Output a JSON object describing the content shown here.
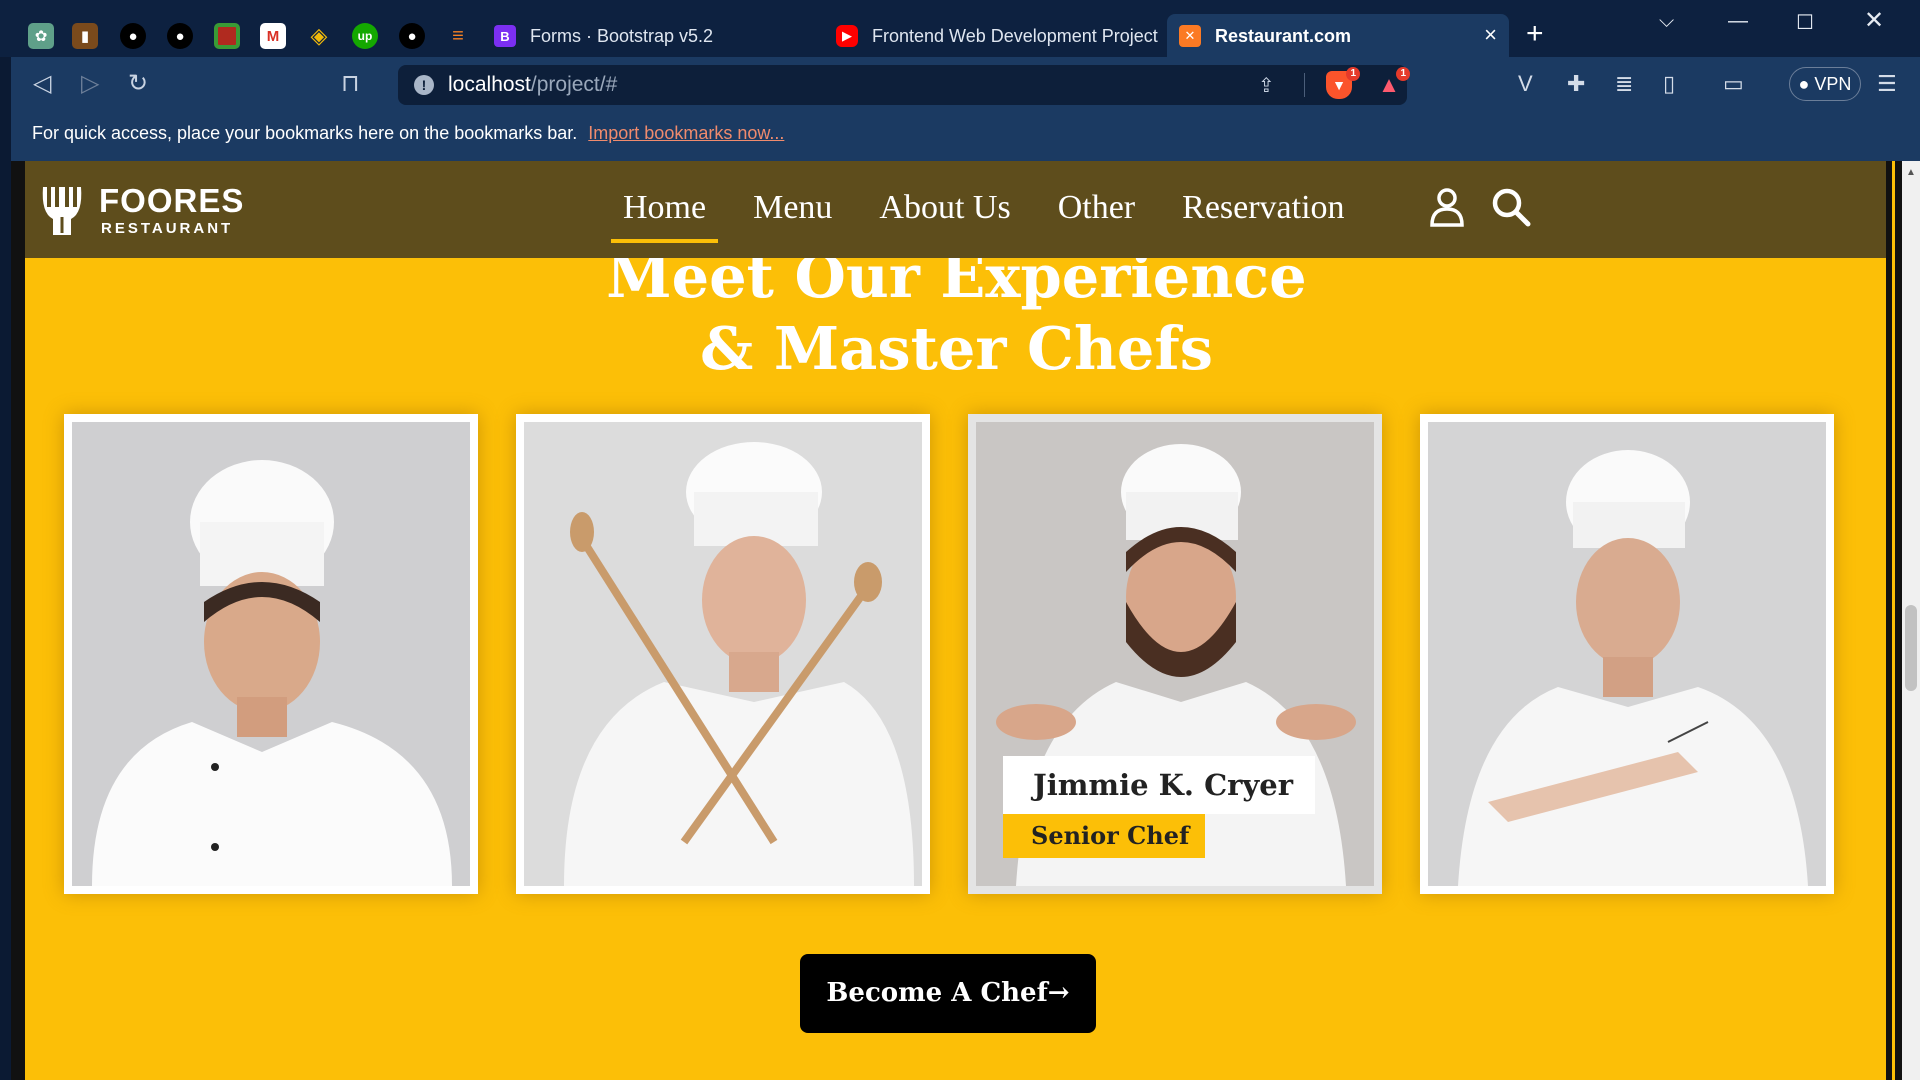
{
  "browser": {
    "tabs": [
      {
        "title": "Forms · Bootstrap v5.2",
        "favicon": "B"
      },
      {
        "title": "Frontend Web Development Project",
        "favicon": "yt"
      },
      {
        "title": "Restaurant.com",
        "favicon": "xampp"
      }
    ],
    "pinned_icons": [
      "openai-icon",
      "book-icon",
      "github-icon",
      "github-icon",
      "green-square-icon",
      "gmail-icon",
      "binance-icon",
      "upwork-icon",
      "github-icon",
      "stackoverflow-icon"
    ],
    "upwork_label": "up",
    "url_host": "localhost",
    "url_path": "/project/#",
    "vpn_label": "VPN",
    "shield_badge": "1",
    "rewards_badge": "1",
    "bookmarks_text": "For quick access, place your bookmarks here on the bookmarks bar.",
    "bookmarks_link": "Import bookmarks now..."
  },
  "site": {
    "brand_name": "FOORES",
    "brand_sub": "RESTAURANT",
    "nav": [
      "Home",
      "Menu",
      "About Us",
      "Other",
      "Reservation"
    ],
    "active_nav": "Home",
    "heading_line1": "Meet Our Experience",
    "heading_line2": "& Master Chefs",
    "chefs": [
      {
        "name": "",
        "role": ""
      },
      {
        "name": "",
        "role": ""
      },
      {
        "name": "Jimmie K. Cryer",
        "role": "Senior Chef"
      },
      {
        "name": "",
        "role": ""
      }
    ],
    "cta_label": "Become A Chef",
    "accent_color": "#fcbf07",
    "nav_bg_color": "#5e4d1c"
  }
}
